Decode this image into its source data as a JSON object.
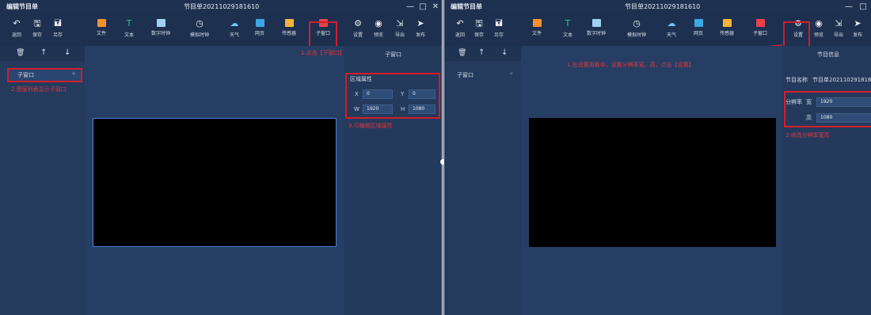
{
  "left": {
    "window_title": "编辑节目单",
    "program_title": "节目单20211029181610",
    "win_controls": [
      "—",
      "□",
      "✕"
    ],
    "toolbar": {
      "back": "返回",
      "save": "保存",
      "save_as": "另存",
      "file": "文件",
      "text": "文本",
      "digital_clock": "数字时钟",
      "analog_clock": "模拟时钟",
      "weather": "天气",
      "webpage": "网页",
      "sensor": "传感器",
      "subwindow": "子窗口",
      "settings": "设置",
      "preview": "预览",
      "export": "导出",
      "publish": "发布"
    },
    "layer_list_item": "子窗口",
    "layer_item_add": "+",
    "panel_title": "子窗口",
    "area_section": "区域属性",
    "area": {
      "x_label": "X",
      "x": "0",
      "y_label": "Y",
      "y": "0",
      "w_label": "W",
      "w": "1920",
      "h_label": "H",
      "h": "1080"
    },
    "annotations": {
      "step1": "1.点击【子窗口】",
      "step2": "2.图层列表显示子窗口",
      "step3": "3.可编辑区域属性"
    }
  },
  "right": {
    "window_title": "编辑节目单",
    "program_title": "节目单20211029181610",
    "win_controls": [
      "—",
      "□"
    ],
    "toolbar": {
      "back": "返回",
      "save": "保存",
      "save_as": "另存",
      "file": "文件",
      "text": "文本",
      "digital_clock": "数字时钟",
      "analog_clock": "模拟时钟",
      "weather": "天气",
      "webpage": "网页",
      "sensor": "传感器",
      "subwindow": "子窗口",
      "settings": "设置",
      "preview": "预览",
      "export": "导出",
      "publish": "发布"
    },
    "layer_list_item": "子窗口",
    "layer_item_add": "+",
    "panel_title": "节目信息",
    "program_name_label": "节目名称",
    "program_name_value": "节目单20211029181610",
    "resolution_label": "分辨率",
    "width_label": "宽",
    "width_value": "1920",
    "height_label": "高",
    "height_value": "1080",
    "annotations": {
      "step1": "1.在设置面板中，设置分辨率宽、高，点击【设置】",
      "step2": "2.修改分辨率宽高"
    }
  },
  "colors": {
    "accent_red": "#d21e2c",
    "background": "#223858",
    "canvas_screen": "#000000"
  }
}
